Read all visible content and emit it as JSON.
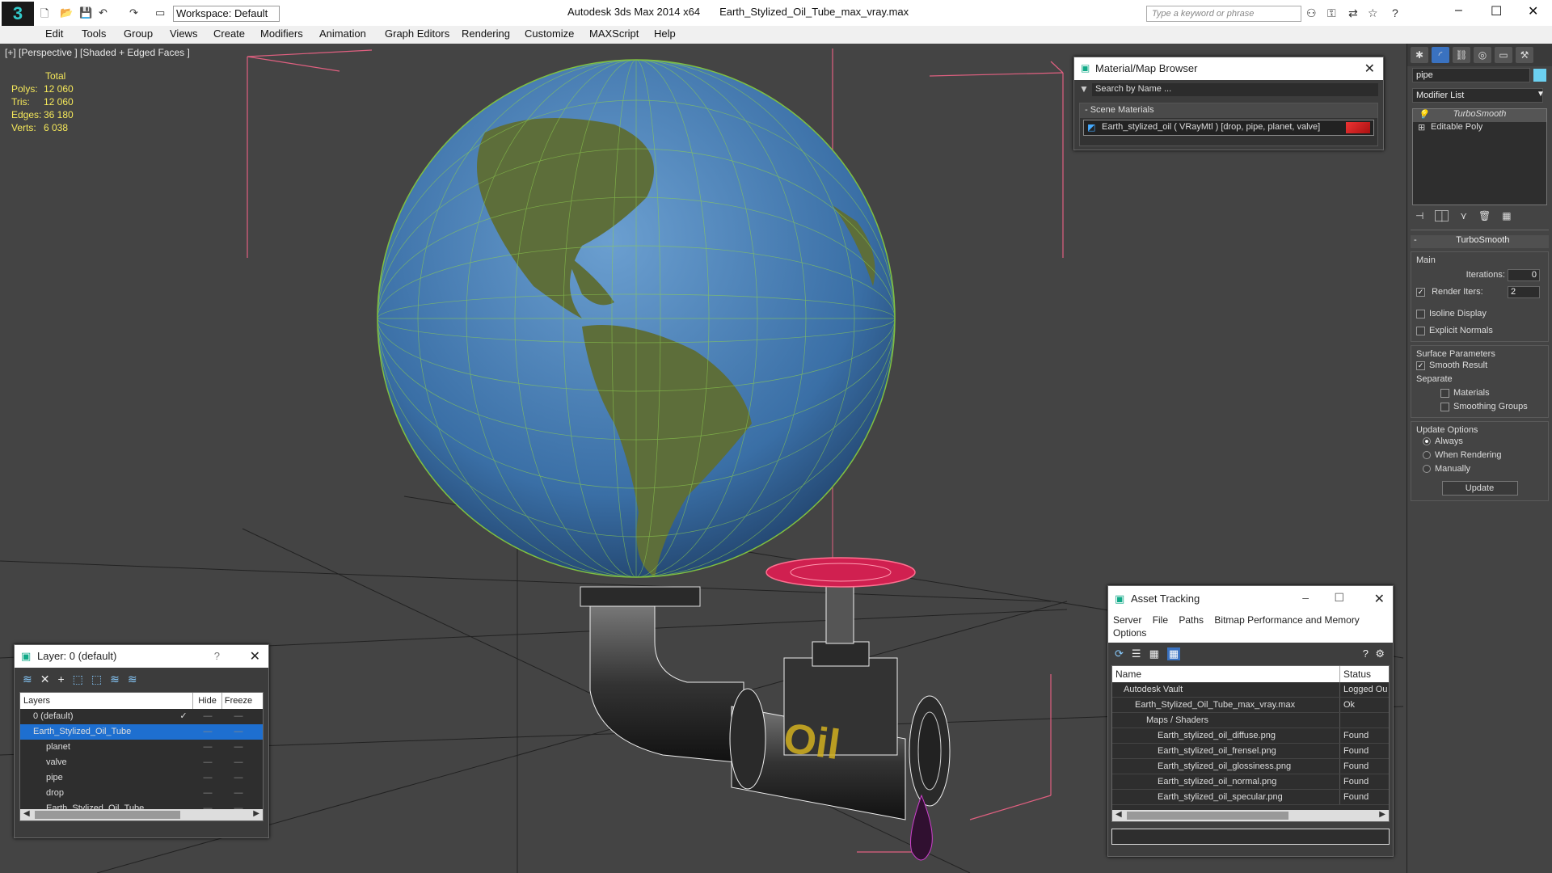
{
  "app": {
    "title": "Autodesk 3ds Max  2014 x64",
    "file": "Earth_Stylized_Oil_Tube_max_vray.max",
    "workspace": "Workspace: Default",
    "search_placeholder": "Type a keyword or phrase"
  },
  "menu": [
    "Edit",
    "Tools",
    "Group",
    "Views",
    "Create",
    "Modifiers",
    "Animation",
    "Graph Editors",
    "Rendering",
    "Customize",
    "MAXScript",
    "Help"
  ],
  "viewport": {
    "label": "[+] [Perspective ] [Shaded + Edged Faces ]",
    "stats": {
      "total_label": "Total",
      "rows": [
        {
          "k": "Polys:",
          "v": "12 060"
        },
        {
          "k": "Tris:",
          "v": "12 060"
        },
        {
          "k": "Edges:",
          "v": "36 180"
        },
        {
          "k": "Verts:",
          "v": "6 038"
        }
      ]
    },
    "pipe_text": "Oil"
  },
  "material_browser": {
    "title": "Material/Map Browser",
    "search_placeholder": "Search by Name ...",
    "group": "- Scene Materials",
    "item": "Earth_stylized_oil  ( VRayMtl )  [drop, pipe, planet, valve]"
  },
  "layer": {
    "title": "Layer: 0 (default)",
    "help": "?",
    "headers": {
      "name": "Layers",
      "hide": "Hide",
      "freeze": "Freeze"
    },
    "rows": [
      {
        "name": "0 (default)",
        "indent": 1,
        "check": "✓",
        "selected": false
      },
      {
        "name": "Earth_Stylized_Oil_Tube",
        "indent": 1,
        "check": "",
        "selected": true
      },
      {
        "name": "planet",
        "indent": 2,
        "check": "",
        "selected": false
      },
      {
        "name": "valve",
        "indent": 2,
        "check": "",
        "selected": false
      },
      {
        "name": "pipe",
        "indent": 2,
        "check": "",
        "selected": false
      },
      {
        "name": "drop",
        "indent": 2,
        "check": "",
        "selected": false
      },
      {
        "name": "Earth_Stylized_Oil_Tube",
        "indent": 2,
        "check": "",
        "selected": false
      }
    ]
  },
  "asset": {
    "title": "Asset Tracking",
    "menu": [
      "Server",
      "File",
      "Paths",
      "Bitmap Performance and Memory"
    ],
    "options": "Options",
    "headers": {
      "name": "Name",
      "status": "Status"
    },
    "rows": [
      {
        "name": "Autodesk Vault",
        "status": "Logged Ou",
        "indent": 1
      },
      {
        "name": "Earth_Stylized_Oil_Tube_max_vray.max",
        "status": "Ok",
        "indent": 2
      },
      {
        "name": "Maps / Shaders",
        "status": "",
        "indent": 3
      },
      {
        "name": "Earth_stylized_oil_diffuse.png",
        "status": "Found",
        "indent": 4
      },
      {
        "name": "Earth_stylized_oil_frensel.png",
        "status": "Found",
        "indent": 4
      },
      {
        "name": "Earth_stylized_oil_glossiness.png",
        "status": "Found",
        "indent": 4
      },
      {
        "name": "Earth_stylized_oil_normal.png",
        "status": "Found",
        "indent": 4
      },
      {
        "name": "Earth_stylized_oil_specular.png",
        "status": "Found",
        "indent": 4
      }
    ]
  },
  "command_panel": {
    "object_name": "pipe",
    "modifier_list": "Modifier List",
    "stack": [
      "TurboSmooth",
      "Editable Poly"
    ],
    "rollout": "TurboSmooth",
    "main": "Main",
    "iterations_label": "Iterations:",
    "iterations": "0",
    "render_iters_label": "Render Iters:",
    "render_iters": "2",
    "isoline": "Isoline Display",
    "explicit": "Explicit Normals",
    "surface": "Surface Parameters",
    "smooth": "Smooth Result",
    "separate": "Separate",
    "materials": "Materials",
    "smoothing": "Smoothing Groups",
    "update_options": "Update Options",
    "always": "Always",
    "when_rendering": "When Rendering",
    "manually": "Manually",
    "update": "Update"
  }
}
